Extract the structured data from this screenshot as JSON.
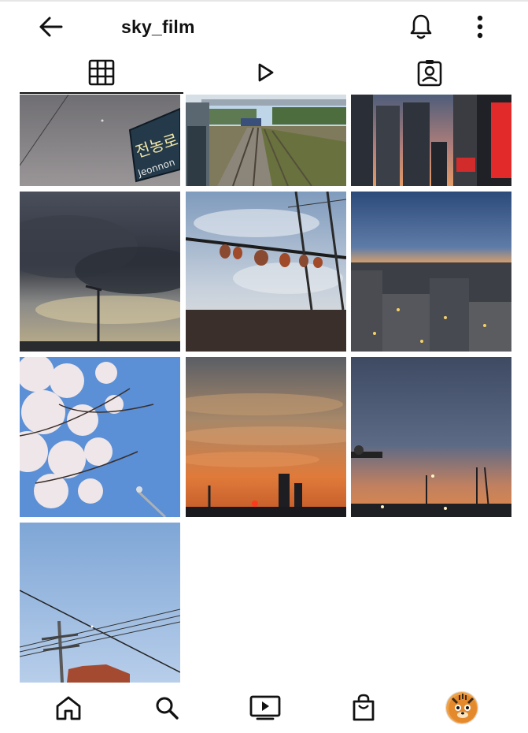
{
  "header": {
    "username": "sky_film",
    "back_icon": "arrow-left-icon",
    "notifications_icon": "bell-icon",
    "more_icon": "more-vertical-icon"
  },
  "tabs": [
    {
      "name": "tab-grid",
      "icon": "grid-icon",
      "active": true
    },
    {
      "name": "tab-reels",
      "icon": "play-icon",
      "active": false
    },
    {
      "name": "tab-tagged",
      "icon": "tagged-portrait-icon",
      "active": false
    }
  ],
  "posts": [
    {
      "id": "post-1",
      "scene": "gray sky with station sign",
      "sign_text": "Jeonnon"
    },
    {
      "id": "post-2",
      "scene": "railway tracks under blue sky"
    },
    {
      "id": "post-3",
      "scene": "city buildings at dusk"
    },
    {
      "id": "post-4",
      "scene": "dark storm clouds with street lamp"
    },
    {
      "id": "post-5",
      "scene": "power lines with hanging lanterns"
    },
    {
      "id": "post-6",
      "scene": "city skyline at twilight"
    },
    {
      "id": "post-7",
      "scene": "cherry blossoms against blue sky"
    },
    {
      "id": "post-8",
      "scene": "orange sunset with clouds"
    },
    {
      "id": "post-9",
      "scene": "dusk sky with street lights"
    },
    {
      "id": "post-10",
      "scene": "blue sky with utility pole"
    }
  ],
  "bottom_nav": [
    {
      "name": "nav-home",
      "icon": "home-icon"
    },
    {
      "name": "nav-search",
      "icon": "search-icon"
    },
    {
      "name": "nav-igtv",
      "icon": "tv-play-icon"
    },
    {
      "name": "nav-shop",
      "icon": "shopping-bag-icon"
    },
    {
      "name": "nav-profile",
      "icon": "avatar"
    }
  ],
  "colors": {
    "text": "#111111",
    "border": "#e6e6e6",
    "background": "#ffffff"
  }
}
